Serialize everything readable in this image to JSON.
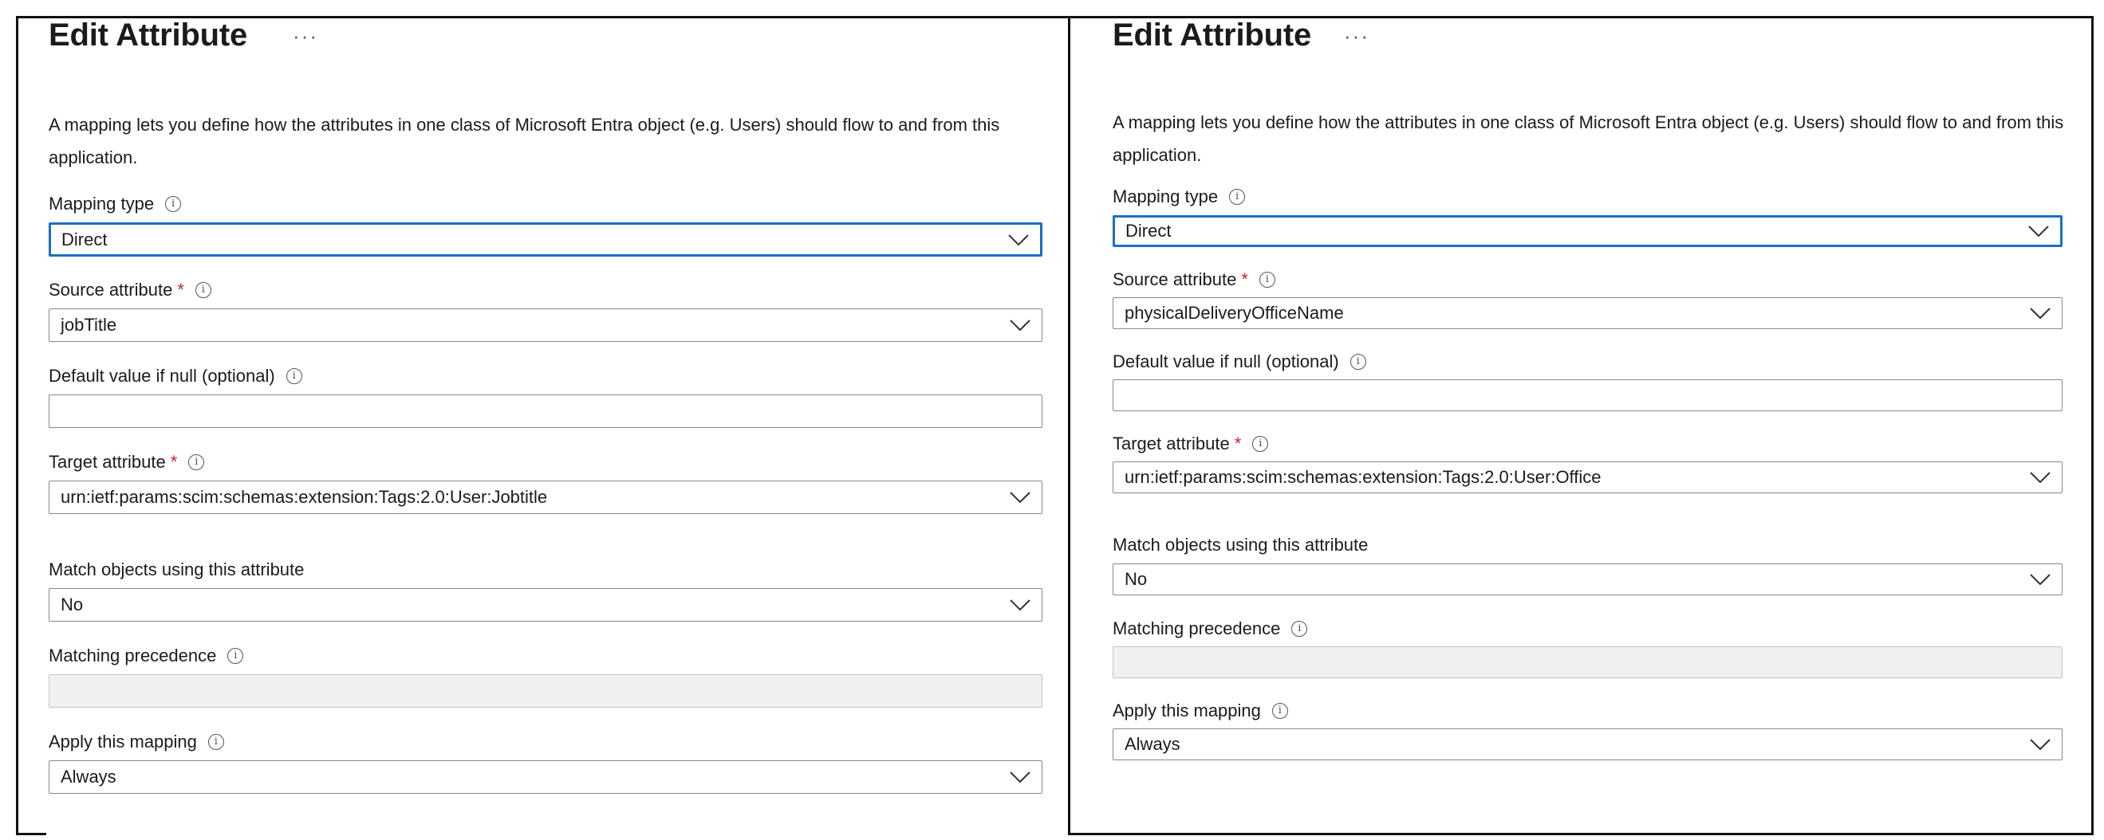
{
  "panels": [
    {
      "title": "Edit Attribute",
      "more": "···",
      "description": "A mapping lets you define how the attributes in one class of Microsoft Entra object (e.g. Users) should flow to and from this application.",
      "mapping_type": {
        "label": "Mapping type",
        "value": "Direct"
      },
      "source_attribute": {
        "label": "Source attribute",
        "required": "*",
        "value": "jobTitle"
      },
      "default_value": {
        "label": "Default value if null (optional)",
        "value": ""
      },
      "target_attribute": {
        "label": "Target attribute",
        "required": "*",
        "value": "urn:ietf:params:scim:schemas:extension:Tags:2.0:User:Jobtitle"
      },
      "match_objects": {
        "label": "Match objects using this attribute",
        "value": "No"
      },
      "matching_precedence": {
        "label": "Matching precedence",
        "value": ""
      },
      "apply_mapping": {
        "label": "Apply this mapping",
        "value": "Always"
      }
    },
    {
      "title": "Edit Attribute",
      "more": "···",
      "description": "A mapping lets you define how the attributes in one class of Microsoft Entra object (e.g. Users) should flow to and from this application.",
      "mapping_type": {
        "label": "Mapping type",
        "value": "Direct"
      },
      "source_attribute": {
        "label": "Source attribute",
        "required": "*",
        "value": "physicalDeliveryOfficeName"
      },
      "default_value": {
        "label": "Default value if null (optional)",
        "value": ""
      },
      "target_attribute": {
        "label": "Target attribute",
        "required": "*",
        "value": "urn:ietf:params:scim:schemas:extension:Tags:2.0:User:Office"
      },
      "match_objects": {
        "label": "Match objects using this attribute",
        "value": "No"
      },
      "matching_precedence": {
        "label": "Matching precedence",
        "value": ""
      },
      "apply_mapping": {
        "label": "Apply this mapping",
        "value": "Always"
      }
    }
  ],
  "info_glyph": "i",
  "colors": {
    "focus_border": "#1a6fc4",
    "required": "#c4262e",
    "disabled_fill": "#f0f0f0"
  },
  "icons": {
    "more": "more-horizontal-icon",
    "info": "info-icon",
    "chevron": "chevron-down-icon"
  }
}
